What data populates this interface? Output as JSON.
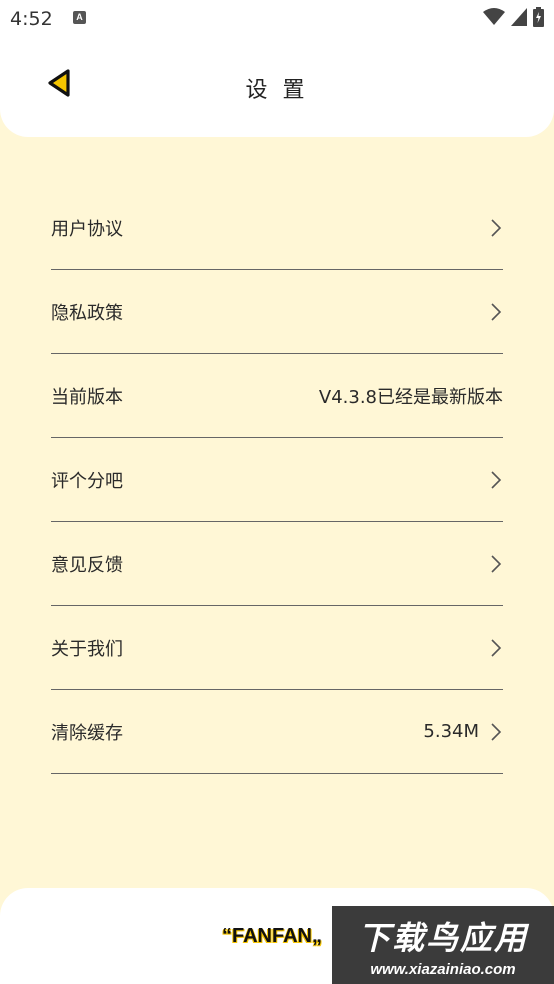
{
  "status_bar": {
    "time": "4:52",
    "icons": [
      "a-notification-icon",
      "wifi-icon",
      "signal-icon",
      "battery-icon"
    ]
  },
  "header": {
    "title": "设 置",
    "back_icon": "back-triangle-icon"
  },
  "settings": {
    "items": [
      {
        "label": "用户协议",
        "value": "",
        "chevron": true
      },
      {
        "label": "隐私政策",
        "value": "",
        "chevron": true
      },
      {
        "label": "当前版本",
        "value": "V4.3.8已经是最新版本",
        "chevron": false
      },
      {
        "label": "评个分吧",
        "value": "",
        "chevron": true
      },
      {
        "label": "意见反馈",
        "value": "",
        "chevron": true
      },
      {
        "label": "关于我们",
        "value": "",
        "chevron": true
      },
      {
        "label": "清除缓存",
        "value": "5.34M",
        "chevron": true
      }
    ]
  },
  "footer": {
    "brand": "“FANFAN„"
  },
  "watermark": {
    "title": "下载鸟应用",
    "url": "www.xiazainiao.com"
  },
  "colors": {
    "page_bg": "#FFF7D6",
    "accent_yellow": "#F5C500",
    "card_bg": "#FFFFFF",
    "divider": "#666666"
  }
}
